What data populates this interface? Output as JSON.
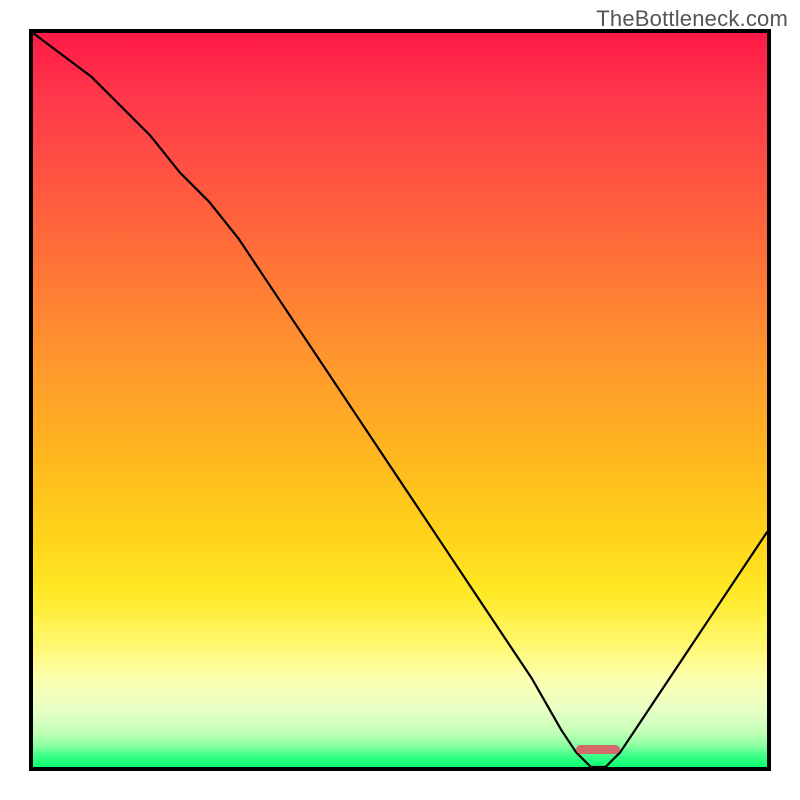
{
  "watermark": "TheBottleneck.com",
  "chart_data": {
    "type": "line",
    "title": "",
    "xlabel": "",
    "ylabel": "",
    "xlim": [
      0,
      100
    ],
    "ylim": [
      0,
      100
    ],
    "grid": false,
    "background": "rainbow-gradient-red-to-green",
    "series": [
      {
        "name": "bottleneck-curve",
        "x": [
          0,
          4,
          8,
          12,
          16,
          20,
          24,
          28,
          32,
          36,
          40,
          44,
          48,
          52,
          56,
          60,
          64,
          68,
          72,
          74,
          76,
          78,
          80,
          84,
          88,
          92,
          96,
          100
        ],
        "values": [
          100,
          97,
          94,
          90,
          86,
          81,
          77,
          72,
          66,
          60,
          54,
          48,
          42,
          36,
          30,
          24,
          18,
          12,
          5,
          2,
          0,
          0,
          2,
          8,
          14,
          20,
          26,
          32
        ]
      }
    ],
    "optimal_range": {
      "x_start": 74,
      "x_end": 80,
      "y": 0
    },
    "annotations": []
  },
  "marker": {
    "left_pct": 74,
    "right_pct": 80,
    "y_pct_from_bottom": 1.0
  }
}
